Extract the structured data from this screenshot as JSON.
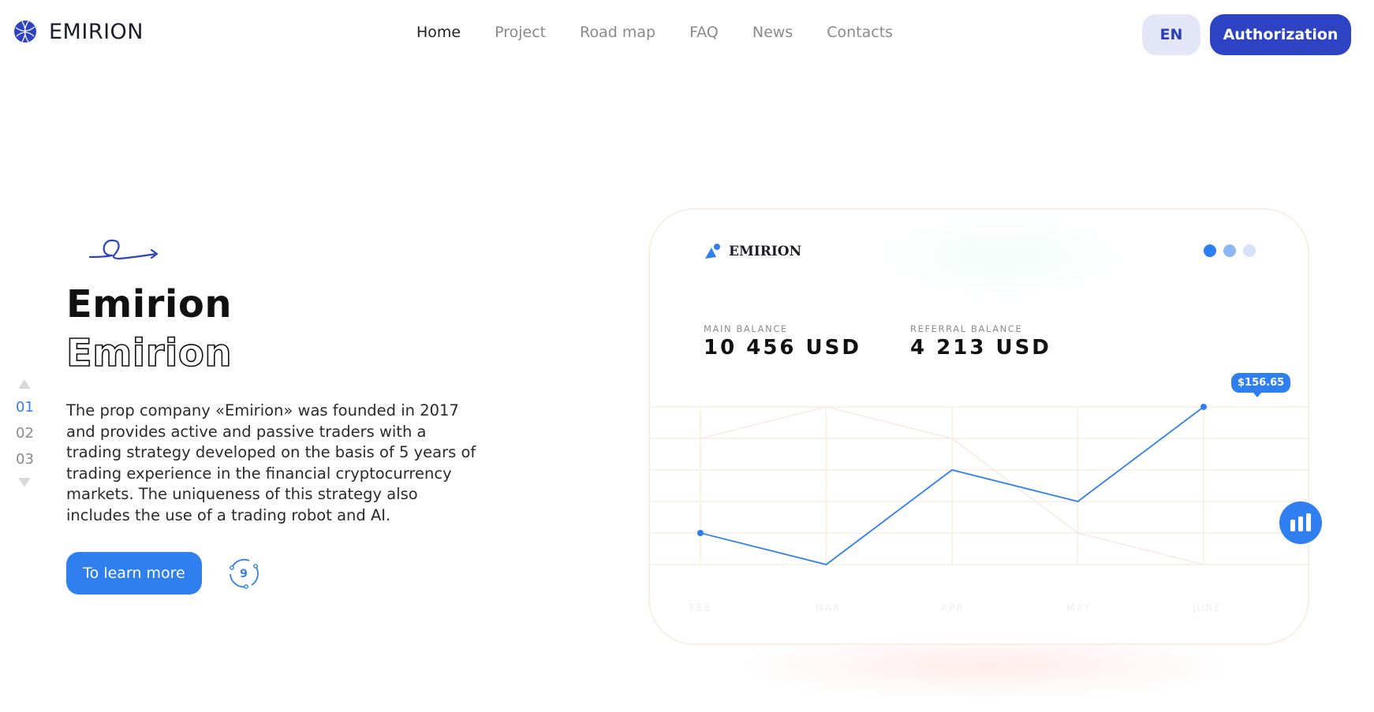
{
  "header": {
    "logo_text": "EMIRION",
    "nav": [
      "Home",
      "Project",
      "Road map",
      "FAQ",
      "News",
      "Contacts"
    ],
    "active_nav": "Home",
    "lang_label": "EN",
    "auth_label": "Authorization"
  },
  "pager": {
    "items": [
      "01",
      "02",
      "03"
    ],
    "active": "01"
  },
  "hero": {
    "title": "Emirion",
    "title_outline": "Emirion",
    "description": "The prop company «Emirion» was founded in 2017 and provides active and passive traders with a trading strategy developed on the basis of 5 years of trading experience in the financial cryptocurrency markets. The uniqueness of this strategy also includes the use of a trading robot and AI.",
    "learn_more_label": "To learn more",
    "counter": "9"
  },
  "card": {
    "logo_text": "EMIRION",
    "main_balance_label": "MAIN BALANCE",
    "main_balance_value": "10 456 USD",
    "referral_balance_label": "REFERRAL BALANCE",
    "referral_balance_value": "4 213 USD",
    "tooltip": "$156.65",
    "dot_colors": [
      "#2f7ff0",
      "#8fb6f4",
      "#d4e3fa"
    ],
    "accent": "#2f7ff0",
    "brand": "#2d43c3"
  },
  "chart_data": {
    "type": "line",
    "categories": [
      "FEB",
      "MAR",
      "APR",
      "MAY",
      "JUNE"
    ],
    "series": [
      {
        "values": [
          2,
          1,
          4,
          3,
          6
        ]
      }
    ],
    "ylim": [
      1,
      6
    ],
    "grid": true,
    "highlight": {
      "category": "JUNE",
      "label": "$156.65"
    }
  }
}
